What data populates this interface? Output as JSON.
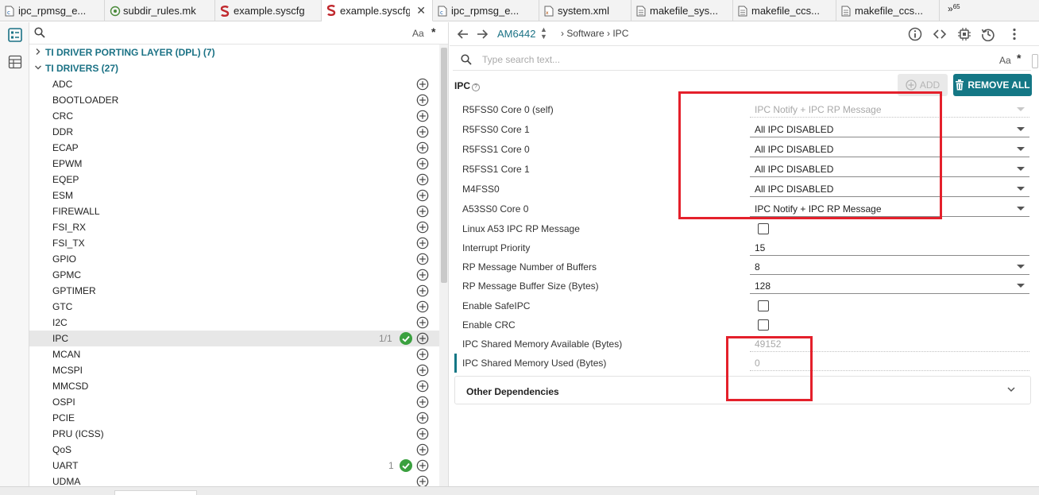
{
  "tabs": [
    {
      "label": "ipc_rpmsg_e...",
      "icon": "c-file-icon",
      "active": false,
      "closable": false
    },
    {
      "label": "subdir_rules.mk",
      "icon": "makefile-icon",
      "active": false,
      "closable": false
    },
    {
      "label": "example.syscfg",
      "icon": "syscfg-icon",
      "active": false,
      "closable": false
    },
    {
      "label": "example.syscfg",
      "icon": "syscfg-icon",
      "active": true,
      "closable": true,
      "close_glyph": "✕"
    },
    {
      "label": "ipc_rpmsg_e...",
      "icon": "c-file-icon",
      "active": false,
      "closable": false
    },
    {
      "label": "system.xml",
      "icon": "xml-file-icon",
      "active": false,
      "closable": false
    },
    {
      "label": "makefile_sys...",
      "icon": "text-file-icon",
      "active": false,
      "closable": false
    },
    {
      "label": "makefile_ccs...",
      "icon": "text-file-icon",
      "active": false,
      "closable": false
    },
    {
      "label": "makefile_ccs...",
      "icon": "text-file-icon",
      "active": false,
      "closable": false
    }
  ],
  "tabs_overflow": {
    "chevron": "»",
    "count": "65"
  },
  "tree": {
    "search_aa": "Aa",
    "search_regex": "*",
    "categories": [
      {
        "label": "TI DRIVER PORTING LAYER (DPL) (7)",
        "expanded": false,
        "chevron": ">"
      },
      {
        "label": "TI DRIVERS (27)",
        "expanded": true,
        "chevron": "v"
      }
    ],
    "items": [
      {
        "label": "ADC",
        "count": "",
        "ok": false,
        "selected": false
      },
      {
        "label": "BOOTLOADER",
        "count": "",
        "ok": false,
        "selected": false
      },
      {
        "label": "CRC",
        "count": "",
        "ok": false,
        "selected": false
      },
      {
        "label": "DDR",
        "count": "",
        "ok": false,
        "selected": false
      },
      {
        "label": "ECAP",
        "count": "",
        "ok": false,
        "selected": false
      },
      {
        "label": "EPWM",
        "count": "",
        "ok": false,
        "selected": false
      },
      {
        "label": "EQEP",
        "count": "",
        "ok": false,
        "selected": false
      },
      {
        "label": "ESM",
        "count": "",
        "ok": false,
        "selected": false
      },
      {
        "label": "FIREWALL",
        "count": "",
        "ok": false,
        "selected": false
      },
      {
        "label": "FSI_RX",
        "count": "",
        "ok": false,
        "selected": false
      },
      {
        "label": "FSI_TX",
        "count": "",
        "ok": false,
        "selected": false
      },
      {
        "label": "GPIO",
        "count": "",
        "ok": false,
        "selected": false
      },
      {
        "label": "GPMC",
        "count": "",
        "ok": false,
        "selected": false
      },
      {
        "label": "GPTIMER",
        "count": "",
        "ok": false,
        "selected": false
      },
      {
        "label": "GTC",
        "count": "",
        "ok": false,
        "selected": false
      },
      {
        "label": "I2C",
        "count": "",
        "ok": false,
        "selected": false
      },
      {
        "label": "IPC",
        "count": "1/1",
        "ok": true,
        "selected": true
      },
      {
        "label": "MCAN",
        "count": "",
        "ok": false,
        "selected": false
      },
      {
        "label": "MCSPI",
        "count": "",
        "ok": false,
        "selected": false
      },
      {
        "label": "MMCSD",
        "count": "",
        "ok": false,
        "selected": false
      },
      {
        "label": "OSPI",
        "count": "",
        "ok": false,
        "selected": false
      },
      {
        "label": "PCIE",
        "count": "",
        "ok": false,
        "selected": false
      },
      {
        "label": "PRU (ICSS)",
        "count": "",
        "ok": false,
        "selected": false
      },
      {
        "label": "QoS",
        "count": "",
        "ok": false,
        "selected": false
      },
      {
        "label": "UART",
        "count": "1",
        "ok": true,
        "selected": false
      },
      {
        "label": "UDMA",
        "count": "",
        "ok": false,
        "selected": false
      }
    ]
  },
  "nav": {
    "device": "AM6442",
    "device_arrows": "▲▼",
    "breadcrumb": "›  Software  ›  IPC",
    "icons": [
      "back-arrow-icon",
      "forward-arrow-icon",
      "info-icon",
      "code-icon",
      "chip-icon",
      "history-icon",
      "more-vertical-icon"
    ]
  },
  "filter": {
    "placeholder": "Type search text...",
    "aa": "Aa",
    "regex": "*"
  },
  "module": {
    "title": "IPC",
    "help": "?",
    "add_label": "ADD",
    "remove_label": "REMOVE ALL"
  },
  "props": [
    {
      "label": "R5FSS0 Core 0 (self)",
      "type": "select",
      "value": "IPC Notify + IPC RP Message",
      "disabled": true
    },
    {
      "label": "R5FSS0 Core 1",
      "type": "select",
      "value": "All IPC DISABLED",
      "disabled": false
    },
    {
      "label": "R5FSS1 Core 0",
      "type": "select",
      "value": "All IPC DISABLED",
      "disabled": false
    },
    {
      "label": "R5FSS1 Core 1",
      "type": "select",
      "value": "All IPC DISABLED",
      "disabled": false
    },
    {
      "label": "M4FSS0",
      "type": "select",
      "value": "All IPC DISABLED",
      "disabled": false
    },
    {
      "label": "A53SS0 Core 0",
      "type": "select",
      "value": "IPC Notify + IPC RP Message",
      "disabled": false
    },
    {
      "label": "Linux A53 IPC RP Message",
      "type": "checkbox",
      "checked": false
    },
    {
      "label": "Interrupt Priority",
      "type": "text",
      "value": "15",
      "disabled": false
    },
    {
      "label": "RP Message Number of Buffers",
      "type": "select",
      "value": "8",
      "disabled": false
    },
    {
      "label": "RP Message Buffer Size (Bytes)",
      "type": "select",
      "value": "128",
      "disabled": false
    },
    {
      "label": "Enable SafeIPC",
      "type": "checkbox",
      "checked": false
    },
    {
      "label": "Enable CRC",
      "type": "checkbox",
      "checked": false
    },
    {
      "label": "IPC Shared Memory Available (Bytes)",
      "type": "text",
      "value": "49152",
      "disabled": true
    },
    {
      "label": "IPC Shared Memory Used (Bytes)",
      "type": "text",
      "value": "0",
      "disabled": true,
      "marker": true
    }
  ],
  "other_dependencies": "Other Dependencies",
  "colors": {
    "accent": "#147785",
    "link": "#1b7285",
    "ok_green": "#3aa03f",
    "highlight_red": "#e4202b"
  }
}
